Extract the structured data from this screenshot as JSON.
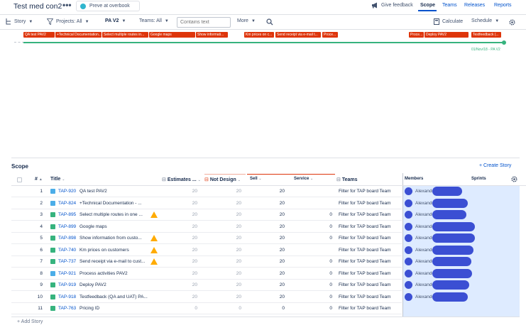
{
  "header": {
    "title": "Test med con2",
    "more": "•••",
    "preview_label": "Preve at overbook",
    "feedback_label": "Give feedback",
    "tabs": [
      "Scope",
      "Teams",
      "Releases",
      "Reports"
    ],
    "active_tab": "Scope"
  },
  "filters": {
    "story": "Story",
    "projects": "Projects: All",
    "plan": "PA V2",
    "teams": "Teams: All",
    "search_placeholder": "Contains text",
    "more": "More",
    "calculate": "Calculate",
    "schedule": "Schedule"
  },
  "timeline": {
    "bars": [
      "QA test PAV2",
      "+Technical Documentation...",
      "Select multiple routes in...",
      "Google maps",
      "Show informati...",
      "Km prices on c...",
      "Send receipt via e-mail t...",
      "Proce...",
      "Proce...",
      "Deploy PAV2",
      "Testfeedback (..."
    ],
    "release_label": "01/Nov/18 - PA V2"
  },
  "scope": {
    "heading": "Scope",
    "create_story": "+ Create Story",
    "add_story": "+ Add Story",
    "columns": {
      "num": "#",
      "title": "Title",
      "estimates": "Estimates ...",
      "not_design": "Not Design",
      "sell": "Sell",
      "service": "Service",
      "teams": "Teams",
      "members": "Members",
      "sprints": "Sprints"
    },
    "rows": [
      {
        "n": "1",
        "type": "task",
        "key": "TAP-920",
        "title": "QA test PAV2",
        "warn": false,
        "est": "20",
        "nd": "20",
        "sell": "20",
        "service": "",
        "team": "Filter for TAP board Team",
        "member": "Alexande"
      },
      {
        "n": "2",
        "type": "task",
        "key": "TAP-824",
        "title": "+Technical Documentation - ...",
        "warn": false,
        "est": "20",
        "nd": "20",
        "sell": "20",
        "service": "",
        "team": "Filter for TAP board Team",
        "member": "Alexande"
      },
      {
        "n": "3",
        "type": "story",
        "key": "TAP-895",
        "title": "Select multiple routes in one ...",
        "warn": true,
        "est": "20",
        "nd": "20",
        "sell": "20",
        "service": "0",
        "team": "Filter for TAP board Team",
        "member": "Alexande"
      },
      {
        "n": "4",
        "type": "story",
        "key": "TAP-899",
        "title": "Google maps",
        "warn": false,
        "est": "20",
        "nd": "20",
        "sell": "20",
        "service": "0",
        "team": "Filter for TAP board Team",
        "member": "Alexande"
      },
      {
        "n": "5",
        "type": "story",
        "key": "TAP-898",
        "title": "Show information from custo...",
        "warn": true,
        "est": "20",
        "nd": "20",
        "sell": "20",
        "service": "0",
        "team": "Filter for TAP board Team",
        "member": "Alexande"
      },
      {
        "n": "6",
        "type": "story",
        "key": "TAP-740",
        "title": "Km prices on customers",
        "warn": true,
        "est": "20",
        "nd": "20",
        "sell": "20",
        "service": "",
        "team": "Filter for TAP board Team",
        "member": "Alexande"
      },
      {
        "n": "7",
        "type": "story",
        "key": "TAP-737",
        "title": "Send receipt via e-mail to cust...",
        "warn": true,
        "est": "20",
        "nd": "20",
        "sell": "20",
        "service": "0",
        "team": "Filter for TAP board Team",
        "member": "Alexande"
      },
      {
        "n": "8",
        "type": "task",
        "key": "TAP-921",
        "title": "Process activities PAV2",
        "warn": false,
        "est": "20",
        "nd": "20",
        "sell": "20",
        "service": "0",
        "team": "Filter for TAP board Team",
        "member": "Alexande"
      },
      {
        "n": "9",
        "type": "story",
        "key": "TAP-919",
        "title": "Deploy PAV2",
        "warn": false,
        "est": "20",
        "nd": "20",
        "sell": "20",
        "service": "0",
        "team": "Filter for TAP board Team",
        "member": "Alexande"
      },
      {
        "n": "10",
        "type": "story",
        "key": "TAP-918",
        "title": "Testfeedback (QA and UAT) PA...",
        "warn": false,
        "est": "20",
        "nd": "20",
        "sell": "20",
        "service": "0",
        "team": "Filter for TAP board Team",
        "member": "Alexande"
      },
      {
        "n": "11",
        "type": "story",
        "key": "TAP-763",
        "title": "Pricing ID",
        "warn": false,
        "est": "0",
        "nd": "0",
        "sell": "0",
        "service": "0",
        "team": "Filter for TAP board Team",
        "member": ""
      }
    ]
  },
  "colors": {
    "accent": "#0052cc",
    "bar": "#de350b",
    "release": "#36b37e",
    "members_bg": "#deebff",
    "redaction": "#3b4fd3"
  }
}
